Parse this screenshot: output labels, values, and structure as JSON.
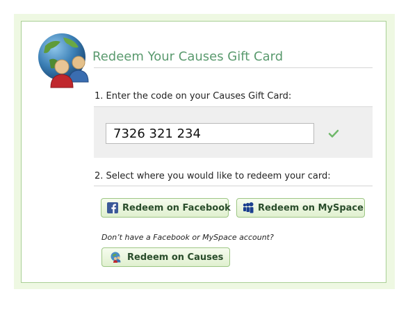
{
  "title": "Redeem Your Causes Gift Card",
  "step1": {
    "label": "1. Enter the code on your Causes Gift Card:",
    "code_value": "7326 321 234"
  },
  "step2": {
    "label": "2. Select where you would like to redeem your card:"
  },
  "buttons": {
    "facebook": "Redeem on Facebook",
    "myspace": "Redeem on MySpace",
    "causes": "Redeem on Causes"
  },
  "no_account_note": "Don’t have a Facebook or MySpace account?",
  "icons": {
    "logo": "globe-people-icon",
    "check": "check-icon",
    "facebook": "facebook-icon",
    "myspace": "myspace-icon",
    "causes": "causes-icon"
  },
  "colors": {
    "page_background": "#eef8e2",
    "card_border": "#a9cf94",
    "title": "#5a9a6e",
    "button_text": "#2a4d2c",
    "button_border": "#9dc684",
    "check": "#6fb86a"
  }
}
